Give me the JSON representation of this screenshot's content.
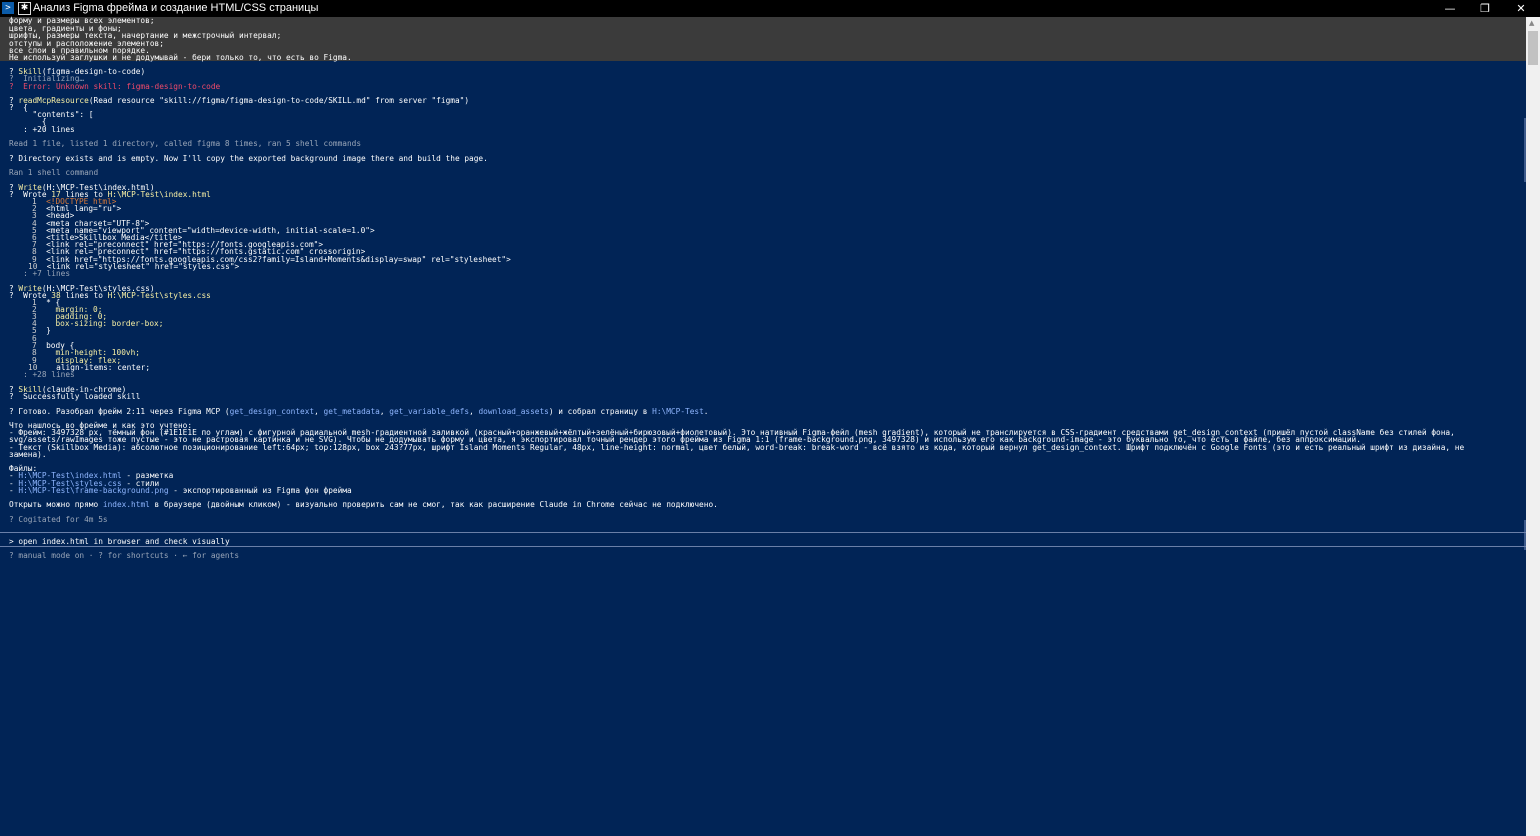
{
  "window": {
    "title": "Анализ Figma фрейма и создание HTML/CSS страницы",
    "minimize": "—",
    "maximize": "❐",
    "close": "✕"
  },
  "top_block": [
    "форму и размеры всех элементов;",
    "цвета, градиенты и фоны;",
    "шрифты, размеры текста, начертание и межстрочный интервал;",
    "отступы и расположение элементов;",
    "все слои в правильном порядке.",
    "Не используй заглушки и не додумывай - бери только то, что есть во Figma."
  ],
  "skill1": {
    "tool": "Skill",
    "arg": "(figma-design-to-code)",
    "line1": "?  Initializing…",
    "line2": "?  Error: Unknown skill: figma-design-to-code"
  },
  "read": {
    "tool": "readMcpResource",
    "arg": "(Read resource \"skill://figma/figma-design-to-code/SKILL.md\" from server \"figma\")",
    "lines": [
      "?  {",
      "     \"contents\": [",
      "       {",
      "   : +20 lines"
    ],
    "summary": "Read 1 file, listed 1 directory, called figma 8 times, ran 5 shell commands"
  },
  "msg1": "? Directory exists and is empty. Now I'll copy the exported background image there and build the page.",
  "ran": "Ran 1 shell command",
  "write1": {
    "tool": "Write",
    "arg": "(H:\\MCP-Test\\index.html)",
    "prefix": "?  Wrote ",
    "count": "17",
    "mid": " lines to ",
    "path": "H:\\MCP-Test\\index.html",
    "code": [
      {
        "n": "1",
        "t": "<!DOCTYPE html>"
      },
      {
        "n": "2",
        "t": "<html lang=\"ru\">"
      },
      {
        "n": "3",
        "t": "<head>"
      },
      {
        "n": "4",
        "t": "<meta charset=\"UTF-8\">"
      },
      {
        "n": "5",
        "t": "<meta name=\"viewport\" content=\"width=device-width, initial-scale=1.0\">"
      },
      {
        "n": "6",
        "t": "<title>Skillbox Media</title>"
      },
      {
        "n": "7",
        "t": "<link rel=\"preconnect\" href=\"https://fonts.googleapis.com\">"
      },
      {
        "n": "8",
        "t": "<link rel=\"preconnect\" href=\"https://fonts.gstatic.com\" crossorigin>"
      },
      {
        "n": "9",
        "t": "<link href=\"https://fonts.googleapis.com/css2?family=Island+Moments&display=swap\" rel=\"stylesheet\">"
      },
      {
        "n": "10",
        "t": "<link rel=\"stylesheet\" href=\"styles.css\">"
      }
    ],
    "more": "   : +7 lines"
  },
  "write2": {
    "tool": "Write",
    "arg": "(H:\\MCP-Test\\styles.css)",
    "prefix": "?  Wrote ",
    "count": "38",
    "mid": " lines to ",
    "path": "H:\\MCP-Test\\styles.css",
    "code": [
      {
        "n": "1",
        "t": "* {"
      },
      {
        "n": "2",
        "t": "  margin: 0;"
      },
      {
        "n": "3",
        "t": "  padding: 0;"
      },
      {
        "n": "4",
        "t": "  box-sizing: border-box;"
      },
      {
        "n": "5",
        "t": "}"
      },
      {
        "n": "6",
        "t": ""
      },
      {
        "n": "7",
        "t": "body {"
      },
      {
        "n": "8",
        "t": "  min-height: 100vh;"
      },
      {
        "n": "9",
        "t": "  display: flex;"
      },
      {
        "n": "10",
        "t": "  align-items: center;"
      }
    ],
    "more": "   : +28 lines"
  },
  "skill2": {
    "tool": "Skill",
    "arg": "(claude-in-chrome)",
    "line1": "?  Successfully loaded skill"
  },
  "done": {
    "a": "? Готово. Разобрал фрейм 2:11 через Figma MCP (",
    "t1": "get_design_context",
    "s1": ", ",
    "t2": "get_metadata",
    "s2": ", ",
    "t3": "get_variable_defs",
    "s3": ", ",
    "t4": "download_assets",
    "b": ") и собрал страницу в ",
    "path": "H:\\MCP-Test",
    "c": "."
  },
  "found_title": "Что нашлось во фрейме и как это учтено:",
  "found": [
    "- Фрейм: 3497328 px, тёмный фон (#1E1E1E по углам) с фигурной радиальной mesh-градиентной заливкой (красный+оранжевый+жёлтый+зелёный+бирюзовый+фиолетовый). Это нативный Figma-фейл (mesh gradient), который не транслируется в CSS-градиент средствами get_design_context (пришёл пустой className без стилей фона,",
    "svg/assets/rawImages тоже пустые - это не растровая картинка и не SVG). Чтобы не додумывать форму и цвета, я экспортировал точный рендер этого фрейма из Figma 1:1 (frame-background.png, 3497328) и использую его как background-image - это буквально то, что есть в файле, без аппроксимаций.",
    "- Текст (Skillbox Media): абсолютное позиционирование left:64px; top:128px, box 243?77px, шрифт Island Moments Regular, 48px, line-height: normal, цвет белый, word-break: break-word - всё взято из кода, который вернул get_design_context. Шрифт подключён с Google Fonts (это и есть реальный шрифт из дизайна, не",
    "замена)."
  ],
  "files_title": "Файлы:",
  "files": [
    {
      "path": "H:\\MCP-Test\\index.html",
      "desc": " - разметка"
    },
    {
      "path": "H:\\MCP-Test\\styles.css",
      "desc": " - стили"
    },
    {
      "path": "H:\\MCP-Test\\frame-background.png",
      "desc": " - экспортированный из Figma фон фрейма"
    }
  ],
  "open": {
    "a": "Открыть можно прямо ",
    "file": "index.html",
    "b": " в браузере (двойным кликом) - визуально проверить сам не смог, так как расширение Claude in Chrome сейчас не подключено."
  },
  "cogitated": "? Cogitated for 4m 5s",
  "input": {
    "prompt": ">",
    "value": "open index.html in browser and check visually"
  },
  "status": "? manual mode on · ? for shortcuts · ← for agents",
  "colors": {
    "background": "#012456",
    "top_block": "#3b3b3b",
    "tool_yellow": "#f9f1a5",
    "error_red": "#f04a6a",
    "path_blue": "#8fb6ff"
  }
}
